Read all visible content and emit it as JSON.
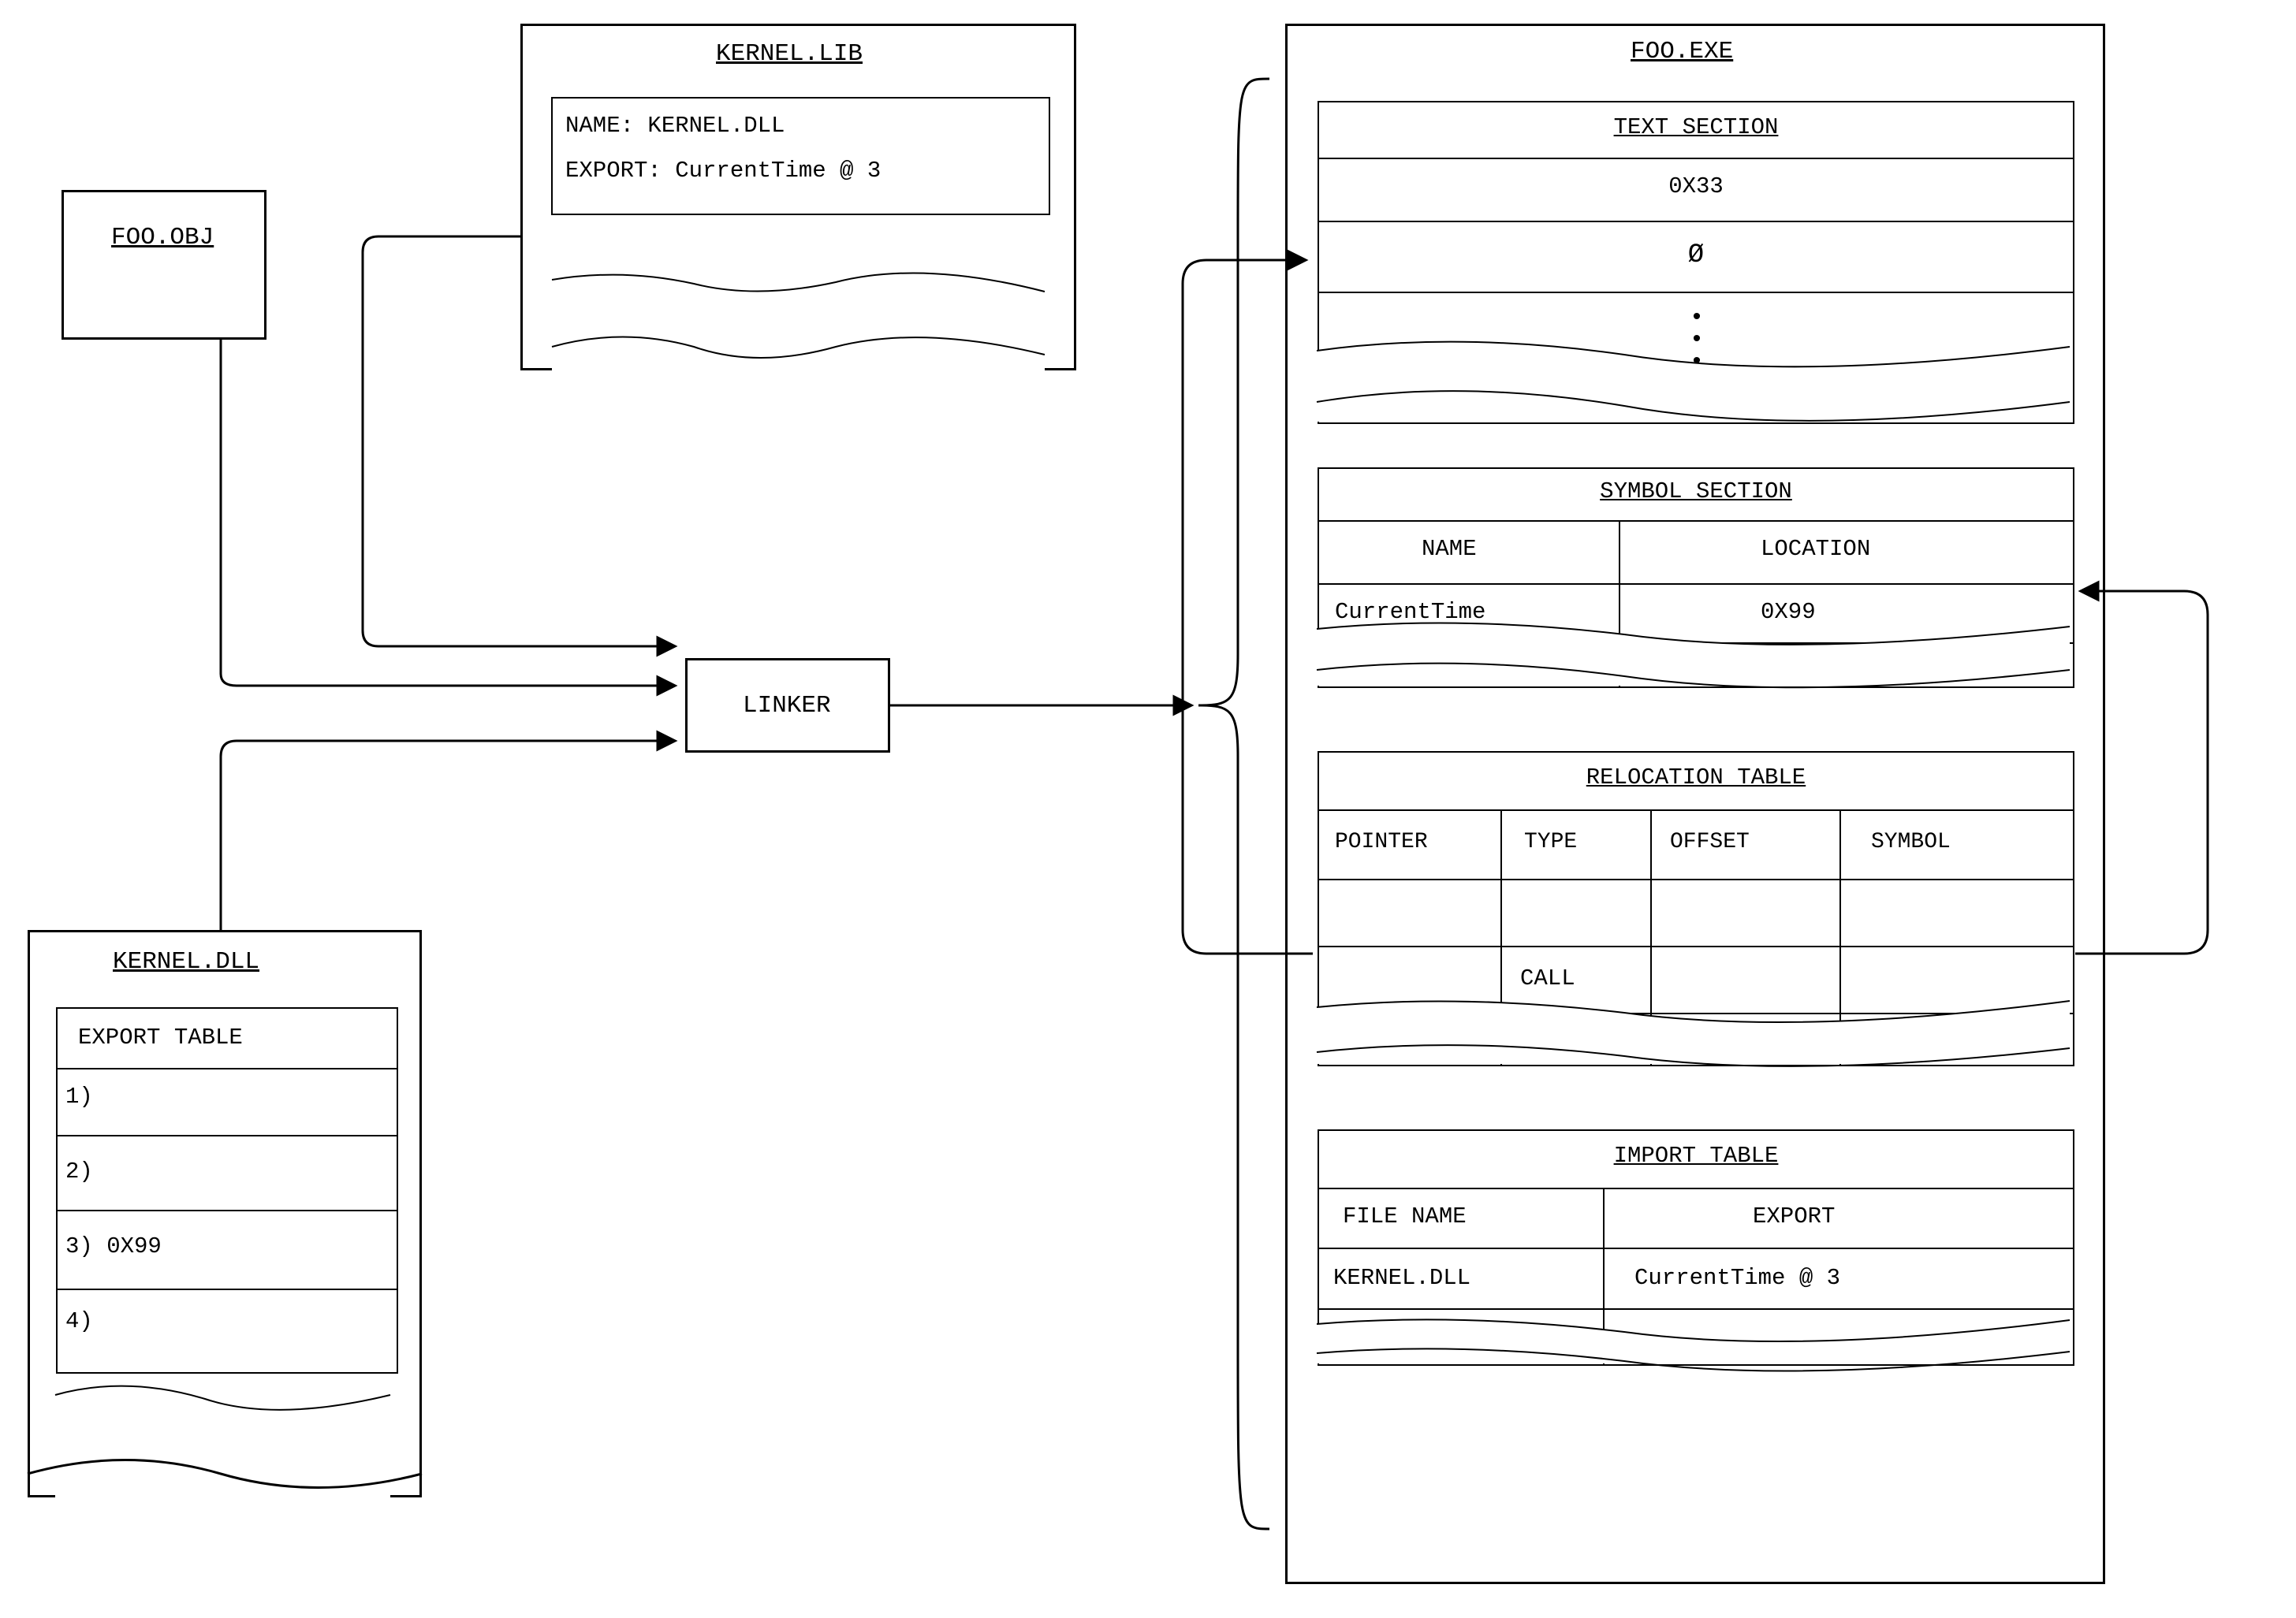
{
  "foo_obj": {
    "title": "FOO.OBJ"
  },
  "kernel_lib": {
    "title": "KERNEL.LIB",
    "name_line": "NAME: KERNEL.DLL",
    "export_line": "EXPORT: CurrentTime  @ 3"
  },
  "linker": {
    "label": "LINKER"
  },
  "kernel_dll": {
    "title": "KERNEL.DLL",
    "table_header": "EXPORT TABLE",
    "rows": {
      "r1": "1)",
      "r2": "2)",
      "r3": "3)   0X99",
      "r4": "4)"
    }
  },
  "foo_exe": {
    "title": "FOO.EXE",
    "text_section": {
      "header": "TEXT SECTION",
      "row1": "0X33",
      "row2": "Ø"
    },
    "symbol_section": {
      "header": "SYMBOL SECTION",
      "col1": "NAME",
      "col2": "LOCATION",
      "data1": "CurrentTime",
      "data2": "0X99"
    },
    "relocation_table": {
      "header": "RELOCATION TABLE",
      "c1": "POINTER",
      "c2": "TYPE",
      "c3": "OFFSET",
      "c4": "SYMBOL",
      "call": "CALL"
    },
    "import_table": {
      "header": "IMPORT TABLE",
      "c1": "FILE NAME",
      "c2": "EXPORT",
      "d1": "KERNEL.DLL",
      "d2": "CurrentTime @ 3"
    }
  }
}
